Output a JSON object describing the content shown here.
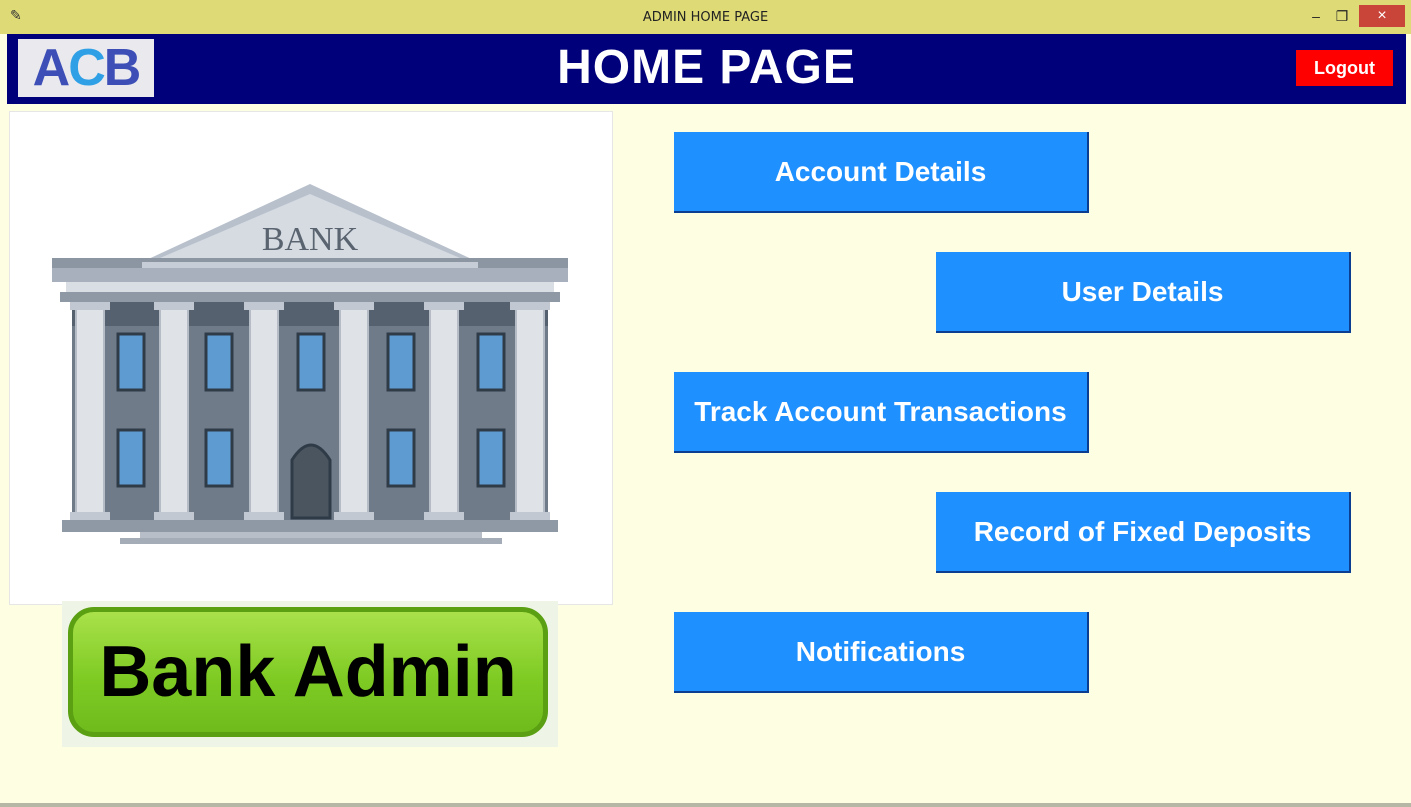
{
  "window": {
    "title": "ADMIN HOME PAGE",
    "minimize": "–",
    "restore": "❐",
    "close": "×"
  },
  "header": {
    "logo_a": "A",
    "logo_c": "C",
    "logo_b": "B",
    "title": "HOME PAGE",
    "logout_label": "Logout"
  },
  "illustration": {
    "sign_text": "BANK"
  },
  "badge": {
    "text": "Bank Admin"
  },
  "nav": {
    "account_details": "Account Details",
    "user_details": "User Details",
    "track_transactions": "Track Account Transactions",
    "fixed_deposits": "Record of Fixed Deposits",
    "notifications": "Notifications"
  },
  "colors": {
    "header_bg": "#00007a",
    "button_bg": "#1e90ff",
    "logout_bg": "#ff0000",
    "page_bg": "#fefee2",
    "titlebar_bg": "#dedb77"
  }
}
